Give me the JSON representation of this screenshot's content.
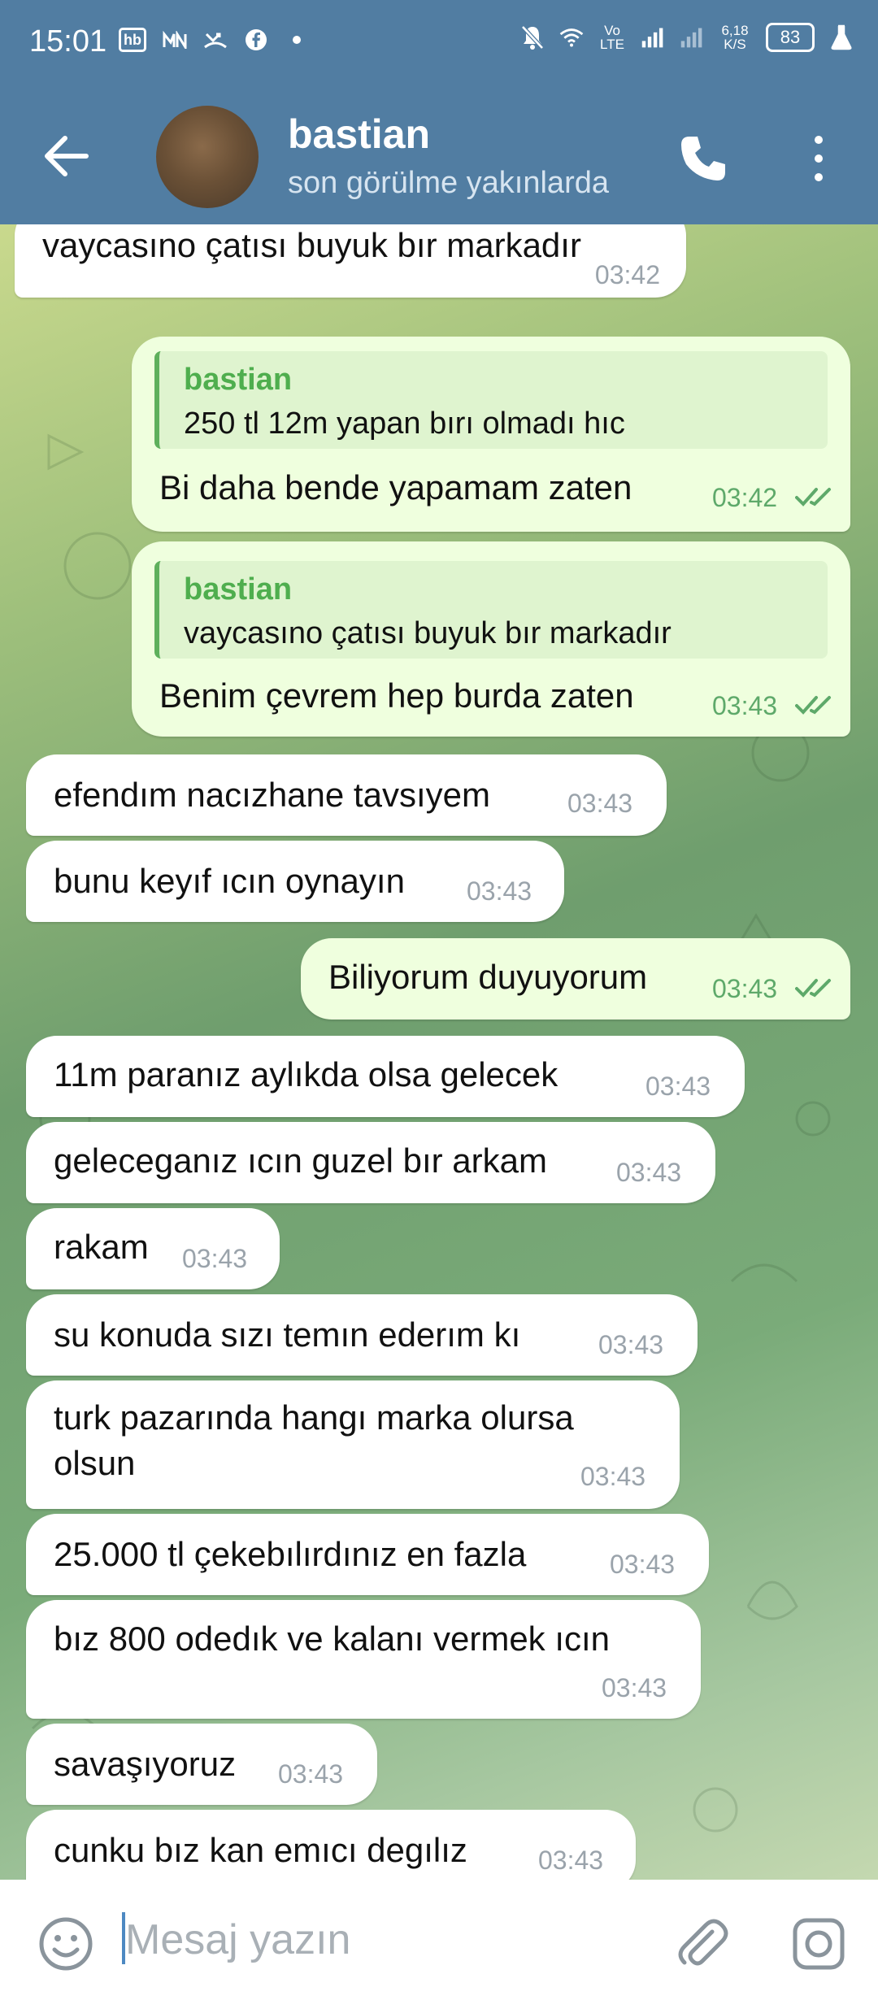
{
  "status_bar": {
    "time": "15:01",
    "left_icons": [
      "hb-icon",
      "network-app-icon",
      "missed-call-icon",
      "facebook-icon",
      "dot-icon"
    ],
    "volte": "Vo LTE",
    "speed": "6,18 K/S",
    "battery": "83"
  },
  "header": {
    "name": "bastian",
    "status": "son görülme yakınlarda"
  },
  "messages": [
    {
      "dir": "in",
      "text": "vaycasıno çatısı buyuk bır markadır",
      "time": "03:42"
    },
    {
      "dir": "out",
      "reply_name": "bastian",
      "reply_text": "250 tl 12m yapan bırı olmadı hıc",
      "text": "Bi daha bende yapamam zaten",
      "time": "03:42",
      "read": true
    },
    {
      "dir": "out",
      "reply_name": "bastian",
      "reply_text": "vaycasıno çatısı buyuk bır markadır",
      "text": "Benim çevrem hep burda zaten",
      "time": "03:43",
      "read": true
    },
    {
      "dir": "in",
      "text": "efendım nacızhane tavsıyem",
      "time": "03:43"
    },
    {
      "dir": "in",
      "text": "bunu keyıf ıcın oynayın",
      "time": "03:43"
    },
    {
      "dir": "out",
      "text": "Biliyorum duyuyorum",
      "time": "03:43",
      "read": true
    },
    {
      "dir": "in",
      "text": "11m paranız aylıkda olsa gelecek",
      "time": "03:43"
    },
    {
      "dir": "in",
      "text": "geleceganız ıcın guzel bır arkam",
      "time": "03:43"
    },
    {
      "dir": "in",
      "text": "rakam",
      "time": "03:43"
    },
    {
      "dir": "in",
      "text": "su konuda sızı temın ederım kı",
      "time": "03:43"
    },
    {
      "dir": "in",
      "text": "turk pazarında hangı marka olursa",
      "text2": "olsun",
      "time": "03:43"
    },
    {
      "dir": "in",
      "text": "25.000 tl çekebılırdınız en fazla",
      "time": "03:43"
    },
    {
      "dir": "in",
      "text": "bız 800 odedık ve kalanı vermek ıcın",
      "time": "03:43"
    },
    {
      "dir": "in",
      "text": "savaşıyoruz",
      "time": "03:43"
    },
    {
      "dir": "in",
      "text": "cunku bız kan emıcı degılız",
      "time": "03:43"
    }
  ],
  "input": {
    "placeholder": "Mesaj yazın"
  },
  "colors": {
    "header": "#517da2",
    "bubble_out": "#efffde",
    "bubble_in": "#ffffff",
    "accent_green": "#5ea96a"
  }
}
